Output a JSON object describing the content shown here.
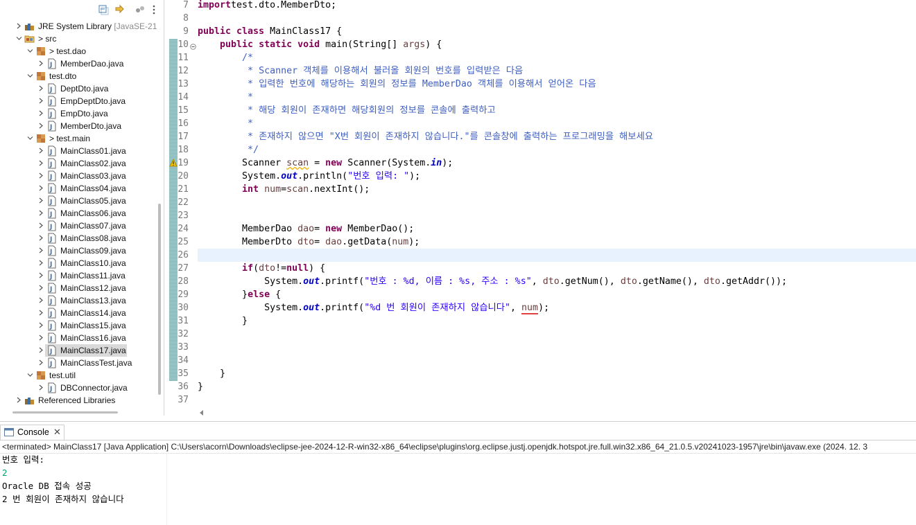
{
  "explorer": {
    "items": [
      {
        "label": "JRE System Library",
        "extra": "[JavaSE-21",
        "depth": 1,
        "expanded": false,
        "icon": "library-icon"
      },
      {
        "label": "src",
        "prefix": "> ",
        "depth": 1,
        "expanded": true,
        "icon": "source-folder-icon"
      },
      {
        "label": "test.dao",
        "prefix": "> ",
        "depth": 2,
        "expanded": true,
        "icon": "package-icon"
      },
      {
        "label": "MemberDao.java",
        "depth": 3,
        "expanded": false,
        "icon": "java-file-icon"
      },
      {
        "label": "test.dto",
        "depth": 2,
        "expanded": true,
        "icon": "package-icon"
      },
      {
        "label": "DeptDto.java",
        "depth": 3,
        "expanded": false,
        "icon": "java-file-icon"
      },
      {
        "label": "EmpDeptDto.java",
        "depth": 3,
        "expanded": false,
        "icon": "java-file-icon"
      },
      {
        "label": "EmpDto.java",
        "depth": 3,
        "expanded": false,
        "icon": "java-file-icon"
      },
      {
        "label": "MemberDto.java",
        "depth": 3,
        "expanded": false,
        "icon": "java-file-icon"
      },
      {
        "label": "test.main",
        "prefix": "> ",
        "depth": 2,
        "expanded": true,
        "icon": "package-icon"
      },
      {
        "label": "MainClass01.java",
        "depth": 3,
        "expanded": false,
        "icon": "java-file-icon"
      },
      {
        "label": "MainClass02.java",
        "depth": 3,
        "expanded": false,
        "icon": "java-file-icon"
      },
      {
        "label": "MainClass03.java",
        "depth": 3,
        "expanded": false,
        "icon": "java-file-icon"
      },
      {
        "label": "MainClass04.java",
        "depth": 3,
        "expanded": false,
        "icon": "java-file-icon"
      },
      {
        "label": "MainClass05.java",
        "depth": 3,
        "expanded": false,
        "icon": "java-file-icon"
      },
      {
        "label": "MainClass06.java",
        "depth": 3,
        "expanded": false,
        "icon": "java-file-icon"
      },
      {
        "label": "MainClass07.java",
        "depth": 3,
        "expanded": false,
        "icon": "java-file-icon"
      },
      {
        "label": "MainClass08.java",
        "depth": 3,
        "expanded": false,
        "icon": "java-file-icon"
      },
      {
        "label": "MainClass09.java",
        "depth": 3,
        "expanded": false,
        "icon": "java-file-icon"
      },
      {
        "label": "MainClass10.java",
        "depth": 3,
        "expanded": false,
        "icon": "java-file-icon"
      },
      {
        "label": "MainClass11.java",
        "depth": 3,
        "expanded": false,
        "icon": "java-file-icon"
      },
      {
        "label": "MainClass12.java",
        "depth": 3,
        "expanded": false,
        "icon": "java-file-icon"
      },
      {
        "label": "MainClass13.java",
        "depth": 3,
        "expanded": false,
        "icon": "java-file-icon"
      },
      {
        "label": "MainClass14.java",
        "depth": 3,
        "expanded": false,
        "icon": "java-file-icon"
      },
      {
        "label": "MainClass15.java",
        "depth": 3,
        "expanded": false,
        "icon": "java-file-icon"
      },
      {
        "label": "MainClass16.java",
        "depth": 3,
        "expanded": false,
        "icon": "java-file-icon"
      },
      {
        "label": "MainClass17.java",
        "depth": 3,
        "expanded": false,
        "icon": "java-file-icon",
        "selected": true
      },
      {
        "label": "MainClassTest.java",
        "depth": 3,
        "expanded": false,
        "icon": "java-file-icon"
      },
      {
        "label": "test.util",
        "depth": 2,
        "expanded": true,
        "icon": "package-icon"
      },
      {
        "label": "DBConnector.java",
        "depth": 3,
        "expanded": false,
        "icon": "java-file-icon"
      },
      {
        "label": "Referenced Libraries",
        "depth": 1,
        "expanded": false,
        "icon": "library-icon"
      }
    ]
  },
  "editor": {
    "first_line_number": 7,
    "current_line": 26,
    "lines": [
      [
        [
          "kw",
          "import"
        ],
        [
          "",
          "test.dto.MemberDto;"
        ]
      ],
      [],
      [
        [
          "kw",
          "public class"
        ],
        [
          "",
          " MainClass17 {"
        ]
      ],
      [
        [
          "",
          "    "
        ],
        [
          "kw",
          "public static void"
        ],
        [
          "",
          " main(String[] "
        ],
        [
          "lv",
          "args"
        ],
        [
          "",
          ") {"
        ]
      ],
      [
        [
          "",
          "        "
        ],
        [
          "cm",
          "/*"
        ]
      ],
      [
        [
          "",
          "        "
        ],
        [
          "cm",
          " * Scanner 객체를 이용해서 불러올 회원의 번호를 입력받은 다음"
        ]
      ],
      [
        [
          "",
          "        "
        ],
        [
          "cm",
          " * 입력한 번호에 해당하는 회원의 정보를 MemberDao 객체를 이용해서 얻어온 다음"
        ]
      ],
      [
        [
          "",
          "        "
        ],
        [
          "cm",
          " *"
        ]
      ],
      [
        [
          "",
          "        "
        ],
        [
          "cm",
          " * 해당 회원이 존재하면 해당회원의 정보를 콘솔에 출력하고"
        ]
      ],
      [
        [
          "",
          "        "
        ],
        [
          "cm",
          " *"
        ]
      ],
      [
        [
          "",
          "        "
        ],
        [
          "cm",
          " * 존재하지 않으면 \"X번 회원이 존재하지 않습니다.\"를 콘솔창에 출력하는 프로그래밍을 해보세요"
        ]
      ],
      [
        [
          "",
          "        "
        ],
        [
          "cm",
          " */"
        ]
      ],
      [
        [
          "",
          "        Scanner "
        ],
        [
          "lv warnu",
          "scan"
        ],
        [
          "",
          " = "
        ],
        [
          "kw",
          "new"
        ],
        [
          "",
          " Scanner(System."
        ],
        [
          "fd",
          "in"
        ],
        [
          "",
          ");"
        ]
      ],
      [
        [
          "",
          "        System."
        ],
        [
          "fd",
          "out"
        ],
        [
          "",
          ".println("
        ],
        [
          "st",
          "\"번호 입력: \""
        ],
        [
          "",
          ");"
        ]
      ],
      [
        [
          "",
          "        "
        ],
        [
          "kw",
          "int"
        ],
        [
          "",
          " "
        ],
        [
          "lv",
          "num"
        ],
        [
          "",
          "="
        ],
        [
          "lv",
          "scan"
        ],
        [
          "",
          ".nextInt();"
        ]
      ],
      [],
      [],
      [
        [
          "",
          "        MemberDao "
        ],
        [
          "lv",
          "dao"
        ],
        [
          "",
          "= "
        ],
        [
          "kw",
          "new"
        ],
        [
          "",
          " MemberDao();"
        ]
      ],
      [
        [
          "",
          "        MemberDto "
        ],
        [
          "lv",
          "dto"
        ],
        [
          "",
          "= "
        ],
        [
          "lv",
          "dao"
        ],
        [
          "",
          ".getData("
        ],
        [
          "lv",
          "num"
        ],
        [
          "",
          ");"
        ]
      ],
      [],
      [
        [
          "",
          "        "
        ],
        [
          "kw",
          "if"
        ],
        [
          "",
          "("
        ],
        [
          "lv",
          "dto"
        ],
        [
          "",
          "!="
        ],
        [
          "kw",
          "null"
        ],
        [
          "",
          ") {"
        ]
      ],
      [
        [
          "",
          "            System."
        ],
        [
          "fd",
          "out"
        ],
        [
          "",
          ".printf("
        ],
        [
          "st",
          "\"번호 : %d, 이름 : %s, 주소 : %s\""
        ],
        [
          "",
          ", "
        ],
        [
          "lv",
          "dto"
        ],
        [
          "",
          ".getNum(), "
        ],
        [
          "lv",
          "dto"
        ],
        [
          "",
          ".getName(), "
        ],
        [
          "lv",
          "dto"
        ],
        [
          "",
          ".getAddr());"
        ]
      ],
      [
        [
          "",
          "        }"
        ],
        [
          "kw",
          "else"
        ],
        [
          "",
          " {"
        ]
      ],
      [
        [
          "",
          "            System."
        ],
        [
          "fd",
          "out"
        ],
        [
          "",
          ".printf("
        ],
        [
          "st",
          "\"%d 번 회원이 존재하지 않습니다\""
        ],
        [
          "",
          ", "
        ],
        [
          "lv erru",
          "num"
        ],
        [
          "",
          ");"
        ]
      ],
      [
        [
          "",
          "        }"
        ]
      ],
      [],
      [],
      [],
      [
        [
          "",
          "    }"
        ]
      ],
      [
        [
          "",
          "}"
        ]
      ],
      []
    ]
  },
  "console": {
    "tab_label": "Console",
    "close_glyph": "✕",
    "header": "<terminated> MainClass17 [Java Application] C:\\Users\\acorn\\Downloads\\eclipse-jee-2024-12-R-win32-x86_64\\eclipse\\plugins\\org.eclipse.justj.openjdk.hotspot.jre.full.win32.x86_64_21.0.5.v20241023-1957\\jre\\bin\\javaw.exe  (2024. 12. 3",
    "output": [
      {
        "text": "번호 입력: ",
        "type": "stdout"
      },
      {
        "text": "2",
        "type": "input"
      },
      {
        "text": "Oracle DB 접속 성공",
        "type": "stdout"
      },
      {
        "text": "2 번 회원이 존재하지 않습니다",
        "type": "stdout"
      }
    ]
  },
  "colors": {
    "keyword": "#7f0055",
    "comment": "#3f5fbf",
    "string": "#2a00ff",
    "field": "#0000c0",
    "local": "#6a3e3e",
    "console_input": "#00a36c",
    "current_line": "#e8f2fe"
  }
}
